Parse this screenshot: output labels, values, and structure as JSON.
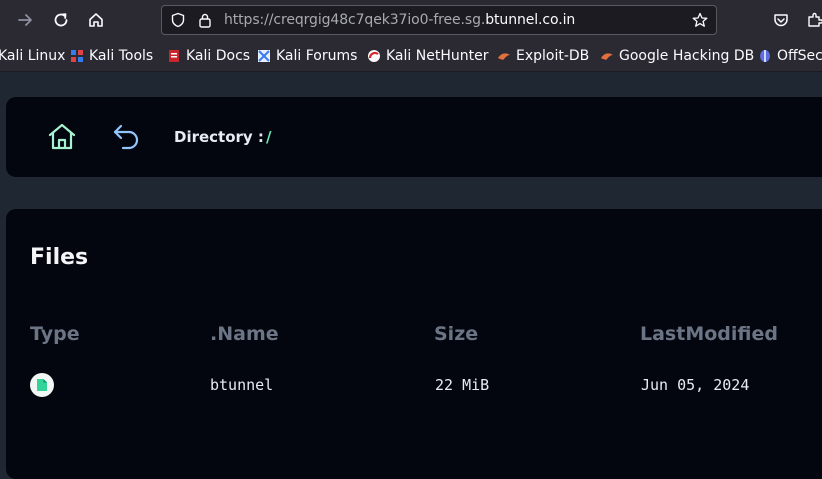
{
  "browser": {
    "url_prefix": "https://creqrgig48c7qek37io0-free.sg.",
    "url_domain": "btunnel.co.in",
    "bookmarks": [
      {
        "label": "Kali Linux",
        "icon": "kali-linux-icon",
        "color": "#367bf0"
      },
      {
        "label": "Kali Tools",
        "icon": "kali-tools-icon",
        "color": "#e04343"
      },
      {
        "label": "Kali Docs",
        "icon": "kali-docs-icon",
        "color": "#c9252d"
      },
      {
        "label": "Kali Forums",
        "icon": "kali-forums-icon",
        "color": "#367bf0"
      },
      {
        "label": "Kali NetHunter",
        "icon": "kali-nethunter-icon",
        "color": "#d9262d"
      },
      {
        "label": "Exploit-DB",
        "icon": "exploit-db-icon",
        "color": "#e0703c"
      },
      {
        "label": "Google Hacking DB",
        "icon": "ghdb-icon",
        "color": "#e0703c"
      },
      {
        "label": "OffSec",
        "icon": "offsec-icon",
        "color": "#5b6ee1"
      }
    ]
  },
  "header": {
    "directory_label": "Directory :",
    "directory_path": "/"
  },
  "files": {
    "title": "Files",
    "columns": [
      "Type",
      ".Name",
      "Size",
      "LastModified"
    ],
    "rows": [
      {
        "type_icon": "file-icon",
        "name": "btunnel",
        "size": "22 MiB",
        "modified": "Jun 05, 2024"
      }
    ]
  },
  "colors": {
    "accent": "#6ee7b7",
    "background": "#1f2733",
    "card": "#03060e"
  }
}
